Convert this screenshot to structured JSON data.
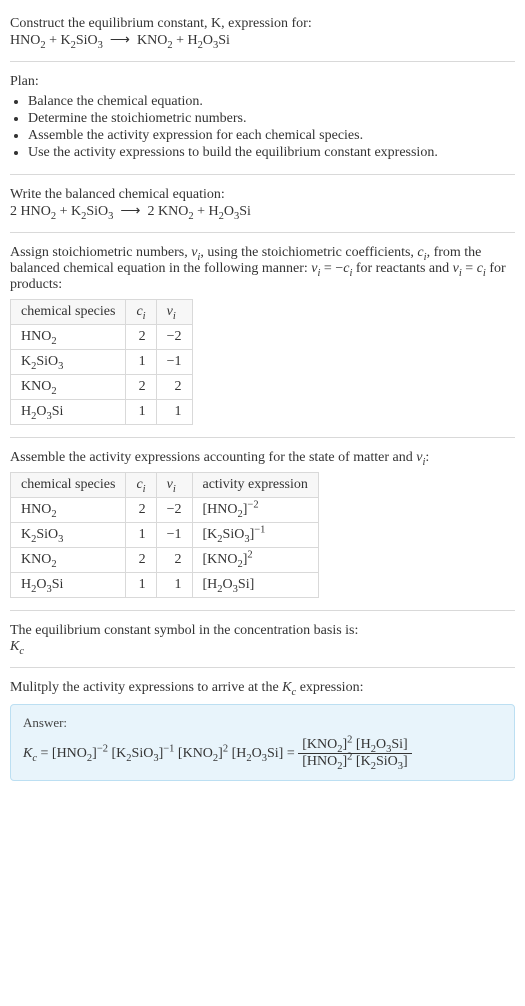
{
  "intro": {
    "line1": "Construct the equilibrium constant, K, expression for:",
    "equation_html": "HNO<sub>2</sub> + K<sub>2</sub>SiO<sub>3</sub> &nbsp;⟶&nbsp; KNO<sub>2</sub> + H<sub>2</sub>O<sub>3</sub>Si"
  },
  "plan": {
    "title": "Plan:",
    "items": [
      "Balance the chemical equation.",
      "Determine the stoichiometric numbers.",
      "Assemble the activity expression for each chemical species.",
      "Use the activity expressions to build the equilibrium constant expression."
    ]
  },
  "balanced": {
    "title": "Write the balanced chemical equation:",
    "equation_html": "2 HNO<sub>2</sub> + K<sub>2</sub>SiO<sub>3</sub> &nbsp;⟶&nbsp; 2 KNO<sub>2</sub> + H<sub>2</sub>O<sub>3</sub>Si"
  },
  "stoich_intro_html": "Assign stoichiometric numbers, <i>ν<sub>i</sub></i>, using the stoichiometric coefficients, <i>c<sub>i</sub></i>, from the balanced chemical equation in the following manner: <i>ν<sub>i</sub></i> = −<i>c<sub>i</sub></i> for reactants and <i>ν<sub>i</sub></i> = <i>c<sub>i</sub></i> for products:",
  "table1": {
    "headers": [
      "chemical species",
      "c_i",
      "ν_i"
    ],
    "headers_html": [
      "chemical species",
      "<i>c<sub>i</sub></i>",
      "<i>ν<sub>i</sub></i>"
    ],
    "rows": [
      {
        "species_html": "HNO<sub>2</sub>",
        "c": "2",
        "nu": "−2"
      },
      {
        "species_html": "K<sub>2</sub>SiO<sub>3</sub>",
        "c": "1",
        "nu": "−1"
      },
      {
        "species_html": "KNO<sub>2</sub>",
        "c": "2",
        "nu": "2"
      },
      {
        "species_html": "H<sub>2</sub>O<sub>3</sub>Si",
        "c": "1",
        "nu": "1"
      }
    ]
  },
  "activity_intro_html": "Assemble the activity expressions accounting for the state of matter and <i>ν<sub>i</sub></i>:",
  "table2": {
    "headers": [
      "chemical species",
      "c_i",
      "ν_i",
      "activity expression"
    ],
    "headers_html": [
      "chemical species",
      "<i>c<sub>i</sub></i>",
      "<i>ν<sub>i</sub></i>",
      "activity expression"
    ],
    "rows": [
      {
        "species_html": "HNO<sub>2</sub>",
        "c": "2",
        "nu": "−2",
        "act_html": "[HNO<sub>2</sub>]<sup>−2</sup>"
      },
      {
        "species_html": "K<sub>2</sub>SiO<sub>3</sub>",
        "c": "1",
        "nu": "−1",
        "act_html": "[K<sub>2</sub>SiO<sub>3</sub>]<sup>−1</sup>"
      },
      {
        "species_html": "KNO<sub>2</sub>",
        "c": "2",
        "nu": "2",
        "act_html": "[KNO<sub>2</sub>]<sup>2</sup>"
      },
      {
        "species_html": "H<sub>2</sub>O<sub>3</sub>Si",
        "c": "1",
        "nu": "1",
        "act_html": "[H<sub>2</sub>O<sub>3</sub>Si]"
      }
    ]
  },
  "kc_symbol": {
    "line": "The equilibrium constant symbol in the concentration basis is:",
    "symbol_html": "<i>K<sub>c</sub></i>"
  },
  "multiply_intro_html": "Mulitply the activity expressions to arrive at the <i>K<sub>c</sub></i> expression:",
  "answer": {
    "label": "Answer:",
    "lhs_html": "<i>K<sub>c</sub></i> = [HNO<sub>2</sub>]<sup>−2</sup> [K<sub>2</sub>SiO<sub>3</sub>]<sup>−1</sup> [KNO<sub>2</sub>]<sup>2</sup> [H<sub>2</sub>O<sub>3</sub>Si] = ",
    "frac_num_html": "[KNO<sub>2</sub>]<sup>2</sup> [H<sub>2</sub>O<sub>3</sub>Si]",
    "frac_den_html": "[HNO<sub>2</sub>]<sup>2</sup> [K<sub>2</sub>SiO<sub>3</sub>]"
  }
}
